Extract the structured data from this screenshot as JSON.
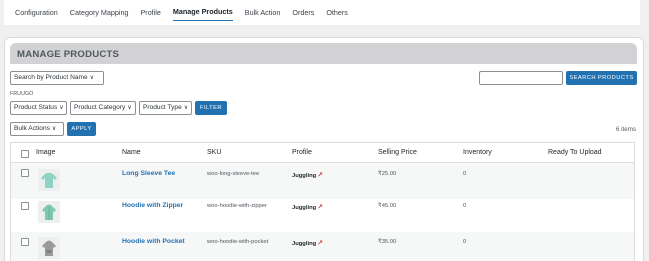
{
  "nav": {
    "tabs": [
      {
        "label": "Configuration"
      },
      {
        "label": "Category Mapping"
      },
      {
        "label": "Profile"
      },
      {
        "label": "Manage Products",
        "active": true
      },
      {
        "label": "Bulk Action"
      },
      {
        "label": "Orders"
      },
      {
        "label": "Others"
      }
    ]
  },
  "panel": {
    "title": "MANAGE PRODUCTS"
  },
  "search": {
    "by_select": "Search by Product Name",
    "input_value": "",
    "button_label": "SEARCH PRODUCTS"
  },
  "filters": {
    "section_label": "FRUUGO",
    "status_select": "Product Status",
    "category_select": "Product Category",
    "type_select": "Product Type",
    "button_label": "FILTER"
  },
  "bulk": {
    "select": "Bulk Actions",
    "button_label": "APPLY",
    "count_text": "6 items"
  },
  "table": {
    "columns": [
      "Image",
      "Name",
      "SKU",
      "Profile",
      "Selling Price",
      "Inventory",
      "Ready To Upload"
    ],
    "rows": [
      {
        "name": "Long Sleeve Tee",
        "sku": "woo-long-sleeve-tee",
        "profile": "Juggling",
        "price": "₹25.00",
        "inventory": "0",
        "ready": "",
        "thumb_icon": "long-sleeve-tee-icon",
        "thumb_color": "#8fd3c6"
      },
      {
        "name": "Hoodie with Zipper",
        "sku": "woo-hoodie-with-zipper",
        "profile": "Juggling",
        "price": "₹45.00",
        "inventory": "0",
        "ready": "",
        "thumb_icon": "hoodie-zipper-icon",
        "thumb_color": "#7cc9b0"
      },
      {
        "name": "Hoodie with Pocket",
        "sku": "woo-hoodie-with-pocket",
        "profile": "Juggling",
        "price": "₹35.00",
        "inventory": "0",
        "ready": "",
        "thumb_icon": "hoodie-pocket-icon",
        "thumb_color": "#9a9a9a"
      }
    ]
  },
  "colors": {
    "accent": "#2271b1",
    "link": "#2271b1",
    "profile_link_icon": "#d63638"
  }
}
